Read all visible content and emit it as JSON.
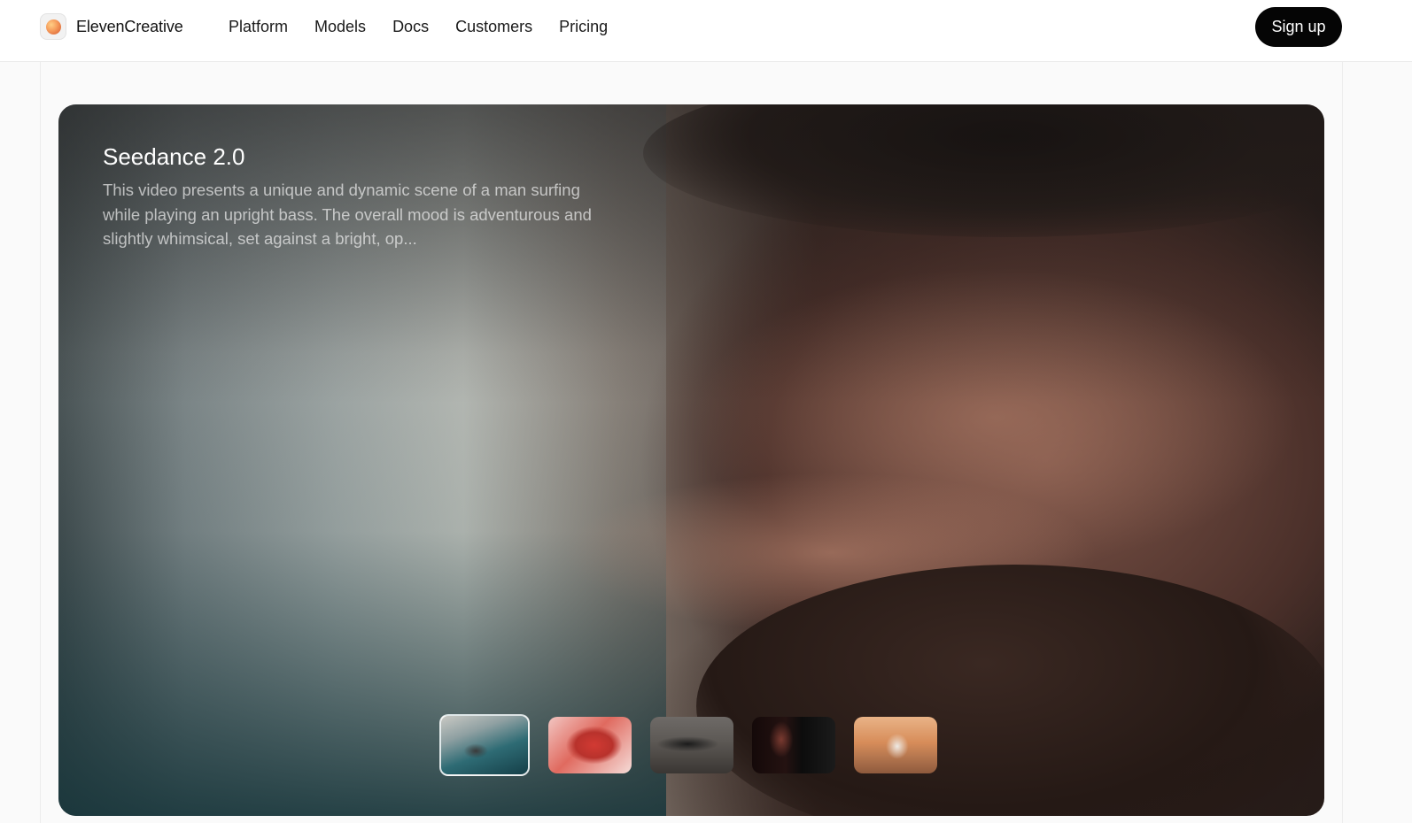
{
  "brand": {
    "name": "ElevenCreative",
    "logo_icon": "orb-logo-icon"
  },
  "nav": {
    "items": [
      {
        "label": "Platform"
      },
      {
        "label": "Models"
      },
      {
        "label": "Docs"
      },
      {
        "label": "Customers"
      },
      {
        "label": "Pricing"
      }
    ]
  },
  "header": {
    "signup_label": "Sign up"
  },
  "hero": {
    "title": "Seedance 2.0",
    "description": "This video presents a unique and dynamic scene of a man surfing while playing an upright bass. The overall mood is adventurous and slightly whimsical, set against a bright, op...",
    "active_thumbnail": 1
  },
  "thumbnails": [
    {
      "name": "surfer"
    },
    {
      "name": "red-cube"
    },
    {
      "name": "race-car"
    },
    {
      "name": "face-portrait"
    },
    {
      "name": "white-horse"
    }
  ],
  "colors": {
    "signup_bg": "#050505",
    "page_bg": "#fafafa",
    "topbar_bg": "#ffffff"
  }
}
